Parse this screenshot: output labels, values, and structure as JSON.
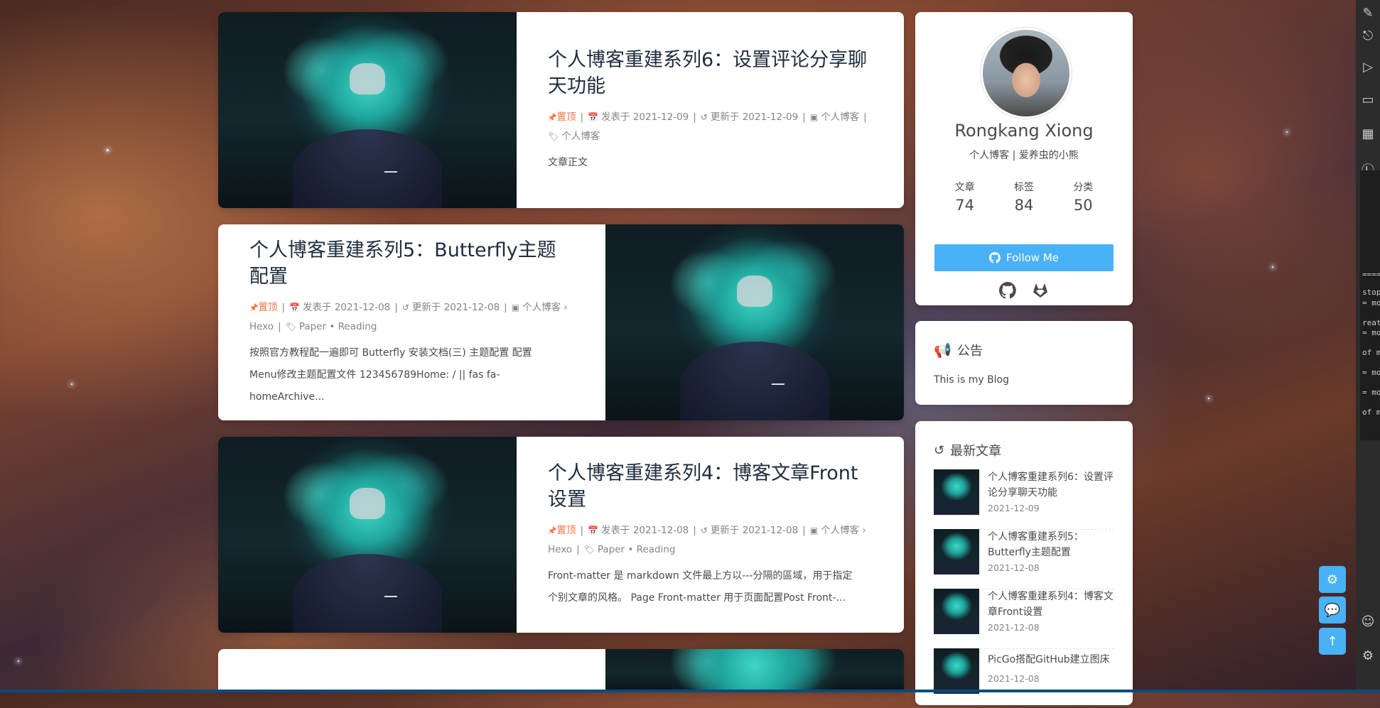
{
  "posts": [
    {
      "title": "个人博客重建系列6：设置评论分享聊天功能",
      "pinned": "置顶",
      "published_label": "发表于",
      "published": "2021-12-09",
      "updated_label": "更新于",
      "updated": "2021-12-09",
      "category": "个人博客",
      "tags": "个人博客",
      "excerpt": "文章正文"
    },
    {
      "title": "个人博客重建系列5：Butterfly主题配置",
      "pinned": "置顶",
      "published_label": "发表于",
      "published": "2021-12-08",
      "updated_label": "更新于",
      "updated": "2021-12-08",
      "category": "个人博客",
      "subcategory": "Hexo",
      "tags": "Paper • Reading",
      "excerpt_1": "按照官方教程配一遍即可 Butterfly 安装文档(三) 主题配置 配置",
      "excerpt_2": "Menu修改主题配置文件 123456789Home: / || fas fa-homeArchive..."
    },
    {
      "title": "个人博客重建系列4：博客文章Front设置",
      "pinned": "置顶",
      "published_label": "发表于",
      "published": "2021-12-08",
      "updated_label": "更新于",
      "updated": "2021-12-08",
      "category": "个人博客",
      "subcategory": "Hexo",
      "tags": "Paper • Reading",
      "excerpt_1": "Front-matter 是 markdown 文件最上方以---分隔的區域，用于指定",
      "excerpt_2": "个别文章的风格。 Page Front-matter 用于页面配置Post Front-..."
    }
  ],
  "author": {
    "name": "Rongkang Xiong",
    "description": "个人博客 | 爱养虫的小熊",
    "stats": [
      {
        "label": "文章",
        "value": "74"
      },
      {
        "label": "标签",
        "value": "84"
      },
      {
        "label": "分类",
        "value": "50"
      }
    ],
    "follow_label": "Follow Me"
  },
  "announcement": {
    "title": "公告",
    "text": "This is my Blog"
  },
  "recent": {
    "title": "最新文章",
    "items": [
      {
        "title": "个人博客重建系列6：设置评论分享聊天功能",
        "date": "2021-12-09"
      },
      {
        "title": "个人博客重建系列5：Butterfly主题配置",
        "date": "2021-12-08"
      },
      {
        "title": "个人博客重建系列4：博客文章Front设置",
        "date": "2021-12-08"
      },
      {
        "title": "PicGo搭配GitHub建立图床",
        "date": "2021-12-08"
      }
    ]
  },
  "colors": {
    "accent": "#49b1f5",
    "pin": "#ff7242",
    "announce_icon": "#ff0000"
  },
  "terminal_fragments": [
    "====",
    "stop",
    "= mod",
    "reate",
    "= mod",
    "of m",
    "= mod",
    "= mod",
    "of m"
  ]
}
